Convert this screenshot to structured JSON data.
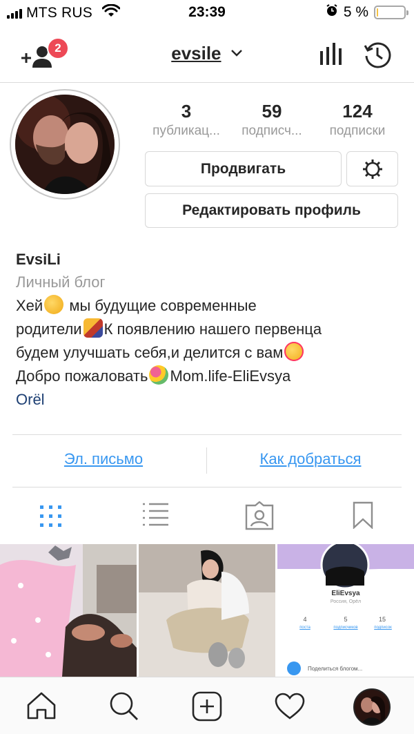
{
  "status_bar": {
    "carrier": "MTS RUS",
    "time": "23:39",
    "battery_text": "5 %",
    "battery_level": 0.05
  },
  "header": {
    "username": "evsile",
    "notification_count": "2"
  },
  "profile": {
    "stats": [
      {
        "value": "3",
        "label": "публикац..."
      },
      {
        "value": "59",
        "label": "подписч..."
      },
      {
        "value": "124",
        "label": "подписки"
      }
    ],
    "promote_button": "Продвигать",
    "edit_button": "Редактировать профиль",
    "name": "EvsiLi",
    "category": "Личный блог",
    "bio": {
      "l1a": "Хей",
      "l1b": " мы будущие современные",
      "l2a": "родители",
      "l2b": "К появлению нашего первенца",
      "l3a": "будем улучшать себя,и делится с вам",
      "l4a": "Добро пожаловать",
      "l4b": "Mom.life-EliEvsya"
    },
    "location": "Orël"
  },
  "contact": {
    "email_label": "Эл. письмо",
    "directions_label": "Как добраться"
  },
  "grid_post3": {
    "name": "EliEvsya",
    "location": "Россия, Орёл",
    "stats": [
      {
        "value": "4",
        "label": "поста"
      },
      {
        "value": "5",
        "label": "подписчиков"
      },
      {
        "value": "15",
        "label": "подписок"
      }
    ],
    "bottom_text": "Поделиться блогом..."
  },
  "colors": {
    "accent": "#3897f0",
    "badge": "#ed4956",
    "text": "#262626",
    "secondary": "#999999",
    "location": "#1d3f73"
  }
}
